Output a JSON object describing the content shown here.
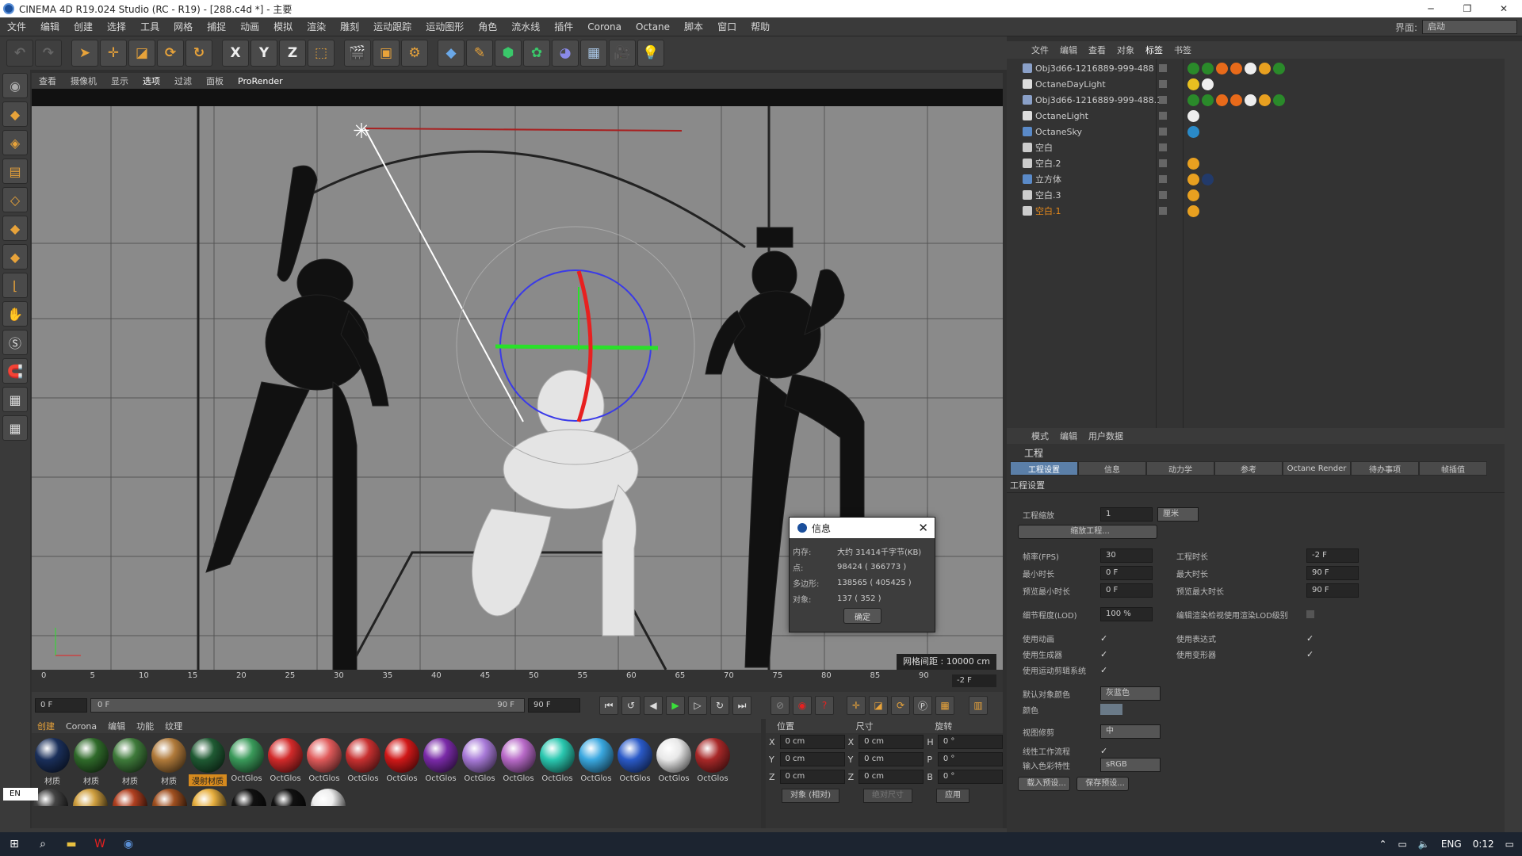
{
  "window": {
    "title": "CINEMA 4D R19.024 Studio (RC - R19) - [288.c4d *] - 主要",
    "controls": [
      "─",
      "❐",
      "✕"
    ]
  },
  "menubar": [
    "文件",
    "编辑",
    "创建",
    "选择",
    "工具",
    "网格",
    "捕捉",
    "动画",
    "模拟",
    "渲染",
    "雕刻",
    "运动跟踪",
    "运动图形",
    "角色",
    "流水线",
    "插件",
    "Corona",
    "Octane",
    "脚本",
    "窗口",
    "帮助"
  ],
  "layout": {
    "label": "界面:",
    "value": "启动"
  },
  "viewport": {
    "menu": [
      "查看",
      "摄像机",
      "显示",
      "选项",
      "过滤",
      "面板",
      "ProRender"
    ],
    "grid_info": "网格间距 : 10000 cm"
  },
  "dialog": {
    "title": "信息",
    "rows": [
      {
        "k": "内存:",
        "v": "大约 31414千字节(KB)"
      },
      {
        "k": "点:",
        "v": "98424 ( 366773 )"
      },
      {
        "k": "多边形:",
        "v": "138565 ( 405425 )"
      },
      {
        "k": "对象:",
        "v": "137 ( 352 )"
      }
    ],
    "ok": "确定"
  },
  "timeline": {
    "ticks": [
      "0",
      "5",
      "10",
      "15",
      "20",
      "25",
      "30",
      "35",
      "40",
      "45",
      "50",
      "55",
      "60",
      "65",
      "70",
      "75",
      "80",
      "85",
      "90"
    ],
    "current": "-2 F"
  },
  "transport": {
    "start": "0 F",
    "range_start": "0 F",
    "range_end": "90 F",
    "end": "90 F"
  },
  "materials": {
    "tabs": [
      "创建",
      "Corona",
      "编辑",
      "功能",
      "纹理"
    ],
    "items": [
      {
        "label": "材质",
        "color": "#1a2f5a"
      },
      {
        "label": "材质",
        "color": "#2f6a2a"
      },
      {
        "label": "材质",
        "color": "#3e7a3a"
      },
      {
        "label": "材质",
        "color": "#b07a3a"
      },
      {
        "label": "漫射材质",
        "color": "#1f5a33",
        "hl": true
      },
      {
        "label": "OctGlos",
        "color": "#3a9a5a"
      },
      {
        "label": "OctGlos",
        "color": "#d22a2a"
      },
      {
        "label": "OctGlos",
        "color": "#e05a5a"
      },
      {
        "label": "OctGlos",
        "color": "#c83030"
      },
      {
        "label": "OctGlos",
        "color": "#d01818"
      },
      {
        "label": "OctGlos",
        "color": "#7a2aa8"
      },
      {
        "label": "OctGlos",
        "color": "#a87ad8"
      },
      {
        "label": "OctGlos",
        "color": "#b86ac8"
      },
      {
        "label": "OctGlos",
        "color": "#2ac8b0"
      },
      {
        "label": "OctGlos",
        "color": "#3aa8e0"
      },
      {
        "label": "OctGlos",
        "color": "#2a5ac8"
      },
      {
        "label": "OctGlos",
        "color": "#e8e8e8"
      },
      {
        "label": "OctGlos",
        "color": "#a82828"
      }
    ],
    "row2": [
      "#444",
      "#d0a040",
      "#b04020",
      "#a05020",
      "#e8b040",
      "#111",
      "#111",
      "#eee"
    ]
  },
  "coords": {
    "headers": [
      "位置",
      "尺寸",
      "旋转"
    ],
    "rows": [
      [
        "X",
        "0 cm",
        "X",
        "0 cm",
        "H",
        "0 °"
      ],
      [
        "Y",
        "0 cm",
        "Y",
        "0 cm",
        "P",
        "0 °"
      ],
      [
        "Z",
        "0 cm",
        "Z",
        "0 cm",
        "B",
        "0 °"
      ]
    ],
    "mode": "对象 (相对)",
    "size_mode": "绝对尺寸",
    "apply": "应用"
  },
  "objmgr": {
    "menu": [
      "文件",
      "编辑",
      "查看",
      "对象",
      "标签",
      "书签"
    ],
    "objects": [
      {
        "name": "Obj3d66-1216889-999-488",
        "icon": "#8aa0c8",
        "tags": [
          "#2a8a2a",
          "#2a8a2a",
          "#e86a1a",
          "#e86a1a",
          "#eee",
          "#e8a020",
          "#2a8a2a"
        ]
      },
      {
        "name": "OctaneDayLight",
        "icon": "#ddd",
        "tags": [
          "#e8c020",
          "#eee"
        ]
      },
      {
        "name": "Obj3d66-1216889-999-488.1",
        "icon": "#8aa0c8",
        "tags": [
          "#2a8a2a",
          "#2a8a2a",
          "#e86a1a",
          "#e86a1a",
          "#eee",
          "#e8a020",
          "#2a8a2a"
        ]
      },
      {
        "name": "OctaneLight",
        "icon": "#ddd",
        "tags": [
          "#eee"
        ]
      },
      {
        "name": "OctaneSky",
        "icon": "#5a8ac8",
        "tags": [
          "#2a8ac8"
        ]
      },
      {
        "name": "空白",
        "icon": "#cccccc",
        "tags": []
      },
      {
        "name": "空白.2",
        "icon": "#cccccc",
        "tags": [
          "#e8a020"
        ]
      },
      {
        "name": "立方体",
        "icon": "#5a8ac8",
        "tags": [
          "#e8a020",
          "#223a6a"
        ]
      },
      {
        "name": "空白.3",
        "icon": "#cccccc",
        "tags": [
          "#e8a020"
        ]
      },
      {
        "name": "空白.1",
        "icon": "#cccccc",
        "tags": [
          "#e8a020"
        ],
        "orange": true
      }
    ]
  },
  "attrmgr": {
    "menu": [
      "模式",
      "编辑",
      "用户数据"
    ],
    "title": "工程",
    "tabs": [
      "工程设置",
      "信息",
      "动力学",
      "参考",
      "Octane Render",
      "待办事项",
      "帧插值"
    ],
    "section": "工程设置",
    "scale_label": "工程缩放",
    "scale_value": "1",
    "scale_unit": "厘米",
    "scale_btn": "缩放工程...",
    "fps_label": "帧率(FPS)",
    "fps": "30",
    "proj_len_label": "工程时长",
    "proj_len": "-2 F",
    "min_label": "最小时长",
    "min": "0 F",
    "max_label": "最大时长",
    "max": "90 F",
    "pmin_label": "预览最小时长",
    "pmin": "0 F",
    "pmax_label": "预览最大时长",
    "pmax": "90 F",
    "lod_label": "细节程度(LOD)",
    "lod": "100 %",
    "lod_edit": "编辑渲染检视使用渲染LOD级别",
    "anim_label": "使用动画",
    "expr_label": "使用表达式",
    "gen_label": "使用生成器",
    "deform_label": "使用变形器",
    "mograph_label": "使用运动剪辑系统",
    "objcolor_label": "默认对象颜色",
    "objcolor": "灰蓝色",
    "color_label": "颜色",
    "clip_label": "视图修剪",
    "clip": "中",
    "linear_label": "线性工作流程",
    "input_label": "输入色彩特性",
    "input": "sRGB",
    "load_btn": "载入预设...",
    "save_btn": "保存预设..."
  },
  "taskbar": {
    "lang": "ENG",
    "time": "0:12"
  },
  "langsel": "EN"
}
